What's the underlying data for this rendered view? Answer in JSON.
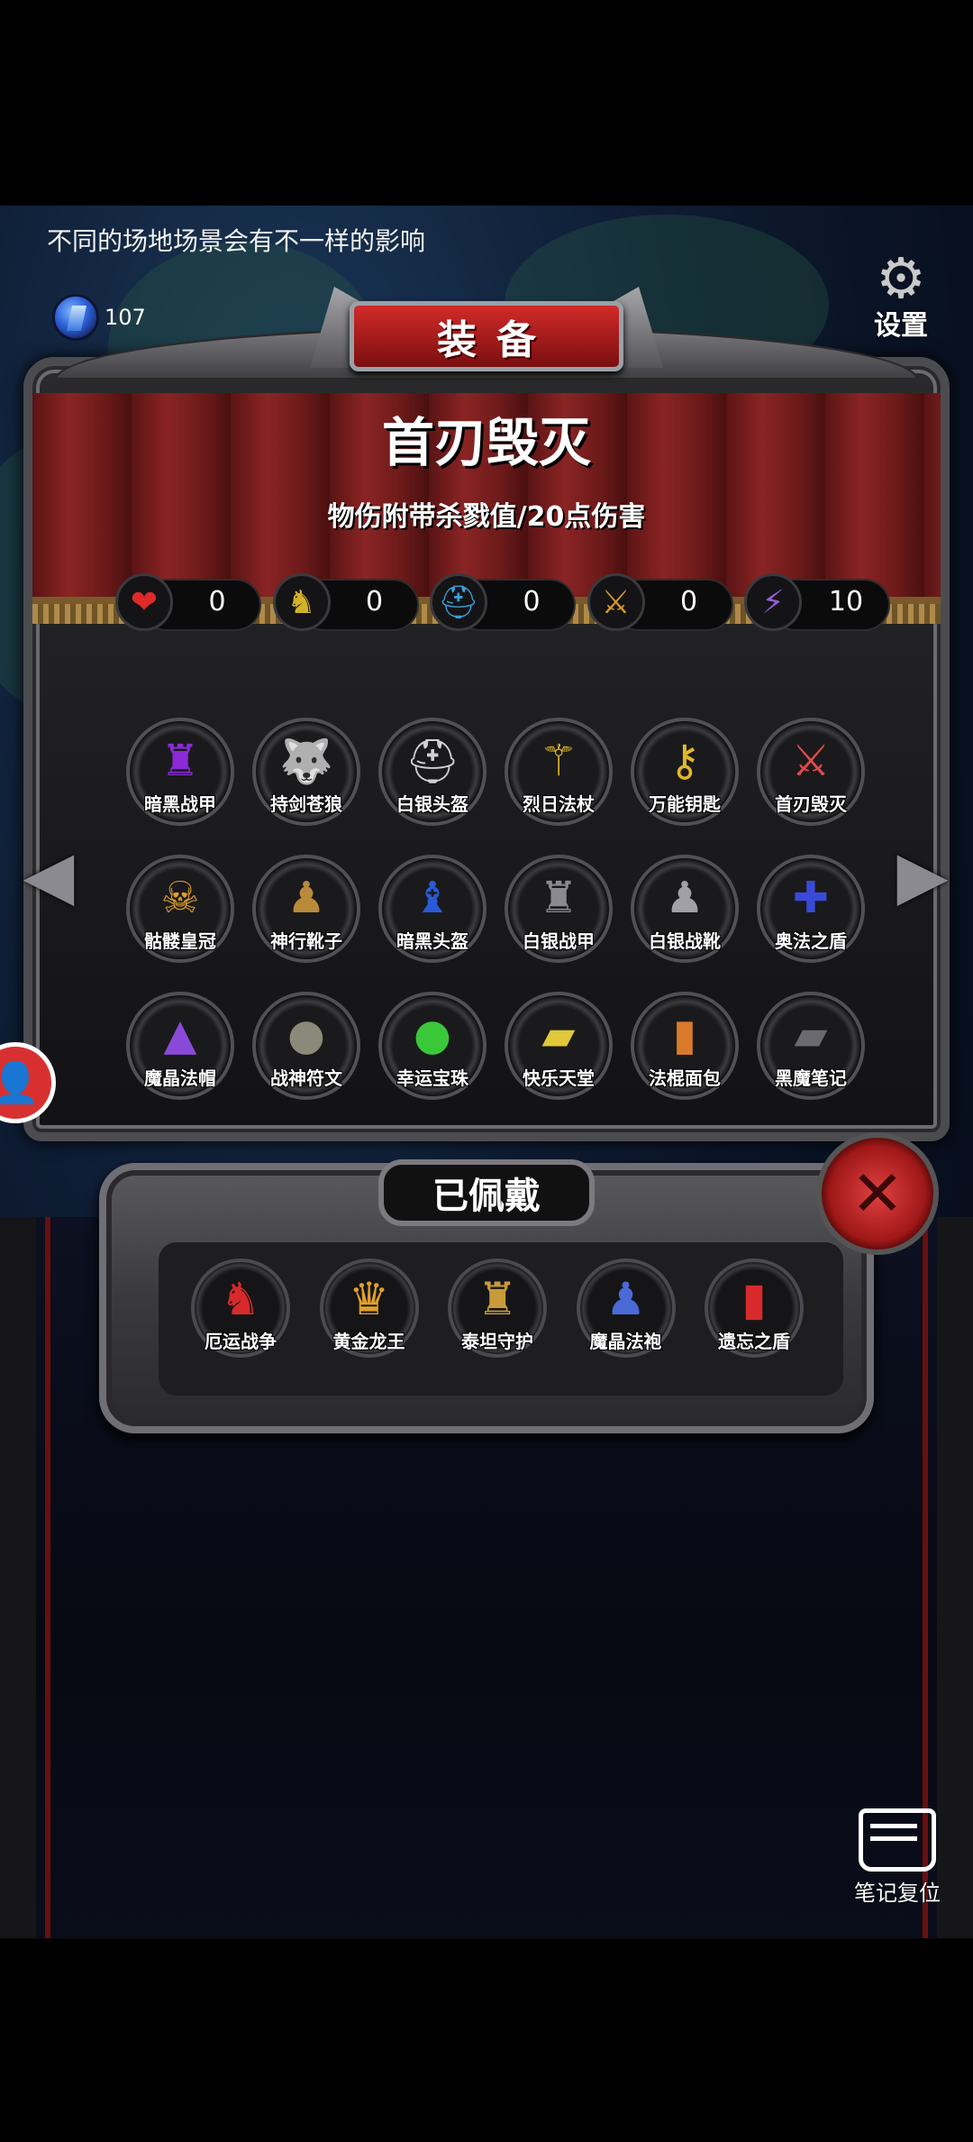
{
  "tip": "不同的场地场景会有不一样的影响",
  "gems": {
    "icon": "blue-gem-icon",
    "count": "107"
  },
  "settings": {
    "icon": "gear-icon",
    "label": "设置"
  },
  "panel": {
    "title": "装备",
    "selected_item": {
      "name": "首刃毁灭",
      "description": "物伤附带杀戮值/20点伤害"
    }
  },
  "stats": [
    {
      "icon": "heart-icon",
      "glyph": "❤",
      "color": "#e02a2a",
      "value": "0"
    },
    {
      "icon": "strength-icon",
      "glyph": "♞",
      "color": "#d4b12a",
      "value": "0"
    },
    {
      "icon": "helmet-icon",
      "glyph": "⛑",
      "color": "#3aa0d8",
      "value": "0"
    },
    {
      "icon": "sword-icon",
      "glyph": "⚔",
      "color": "#d89a2a",
      "value": "0"
    },
    {
      "icon": "lightning-icon",
      "glyph": "⚡",
      "color": "#9a5ad8",
      "value": "10"
    }
  ],
  "items": [
    {
      "label": "暗黑战甲",
      "icon": "dark-armor-icon",
      "glyph": "♜",
      "color": "#8a2ad8"
    },
    {
      "label": "持剑苍狼",
      "icon": "wolf-icon",
      "glyph": "🐺",
      "color": "#9a9aa0"
    },
    {
      "label": "白银头盔",
      "icon": "silver-helmet-icon",
      "glyph": "⛑",
      "color": "#d0d0d4"
    },
    {
      "label": "烈日法杖",
      "icon": "staff-icon",
      "glyph": "⚚",
      "color": "#e0b82a"
    },
    {
      "label": "万能钥匙",
      "icon": "key-icon",
      "glyph": "⚷",
      "color": "#e0b82a"
    },
    {
      "label": "首刃毁灭",
      "icon": "blade-icon",
      "glyph": "⚔",
      "color": "#e04a4a"
    },
    {
      "label": "骷髅皇冠",
      "icon": "skull-crown-icon",
      "glyph": "☠",
      "color": "#e0a02a"
    },
    {
      "label": "神行靴子",
      "icon": "boots-icon",
      "glyph": "♟",
      "color": "#b88a3a"
    },
    {
      "label": "暗黑头盔",
      "icon": "dark-helmet-icon",
      "glyph": "♝",
      "color": "#2a5ad8"
    },
    {
      "label": "白银战甲",
      "icon": "silver-armor-icon",
      "glyph": "♜",
      "color": "#8a8a90"
    },
    {
      "label": "白银战靴",
      "icon": "silver-boots-icon",
      "glyph": "♟",
      "color": "#a0a0a6"
    },
    {
      "label": "奥法之盾",
      "icon": "arcane-shield-icon",
      "glyph": "✚",
      "color": "#3a4ad8"
    },
    {
      "label": "魔晶法帽",
      "icon": "wizard-hat-icon",
      "glyph": "▲",
      "color": "#8a4ad8"
    },
    {
      "label": "战神符文",
      "icon": "rune-icon",
      "glyph": "●",
      "color": "#8a8a7a"
    },
    {
      "label": "幸运宝珠",
      "icon": "lucky-orb-icon",
      "glyph": "●",
      "color": "#3ac83a"
    },
    {
      "label": "快乐天堂",
      "icon": "golden-book-icon",
      "glyph": "▰",
      "color": "#e0c83a"
    },
    {
      "label": "法棍面包",
      "icon": "baguette-icon",
      "glyph": "▮",
      "color": "#d87a2a"
    },
    {
      "label": "黑魔笔记",
      "icon": "dark-book-icon",
      "glyph": "▰",
      "color": "#6a6a70"
    }
  ],
  "equipped": {
    "title": "已佩戴",
    "items": [
      {
        "label": "厄运战争",
        "icon": "red-knight-icon",
        "glyph": "♞",
        "color": "#d82a2a"
      },
      {
        "label": "黄金龙王",
        "icon": "golden-dragon-icon",
        "glyph": "♛",
        "color": "#e0a02a"
      },
      {
        "label": "泰坦守护",
        "icon": "titan-icon",
        "glyph": "♜",
        "color": "#c89a3a"
      },
      {
        "label": "魔晶法袍",
        "icon": "robe-icon",
        "glyph": "♟",
        "color": "#4a6ad8"
      },
      {
        "label": "遗忘之盾",
        "icon": "red-shield-icon",
        "glyph": "▮",
        "color": "#d82a2a"
      }
    ]
  },
  "close": {
    "icon": "close-icon"
  },
  "reset": {
    "icon": "notebook-icon",
    "label": "笔记复位"
  }
}
